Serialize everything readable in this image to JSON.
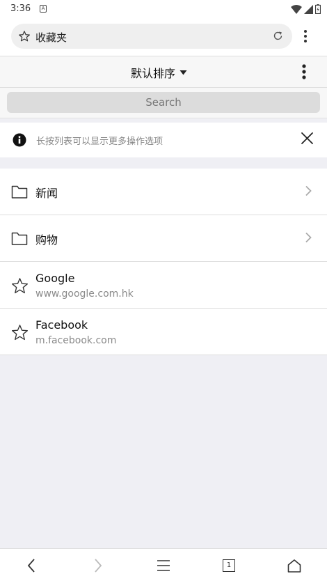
{
  "status": {
    "time": "3:36",
    "notif_icon": "A"
  },
  "urlbar": {
    "text": "收藏夹"
  },
  "sort": {
    "label": "默认排序"
  },
  "search": {
    "placeholder": "Search"
  },
  "tip": {
    "text": "长按列表可以显示更多操作选项"
  },
  "folders": [
    {
      "name": "新闻"
    },
    {
      "name": "购物"
    }
  ],
  "bookmarks": [
    {
      "title": "Google",
      "url": "www.google.com.hk"
    },
    {
      "title": "Facebook",
      "url": "m.facebook.com"
    }
  ],
  "bottom_nav": {
    "tab_count": "1"
  }
}
